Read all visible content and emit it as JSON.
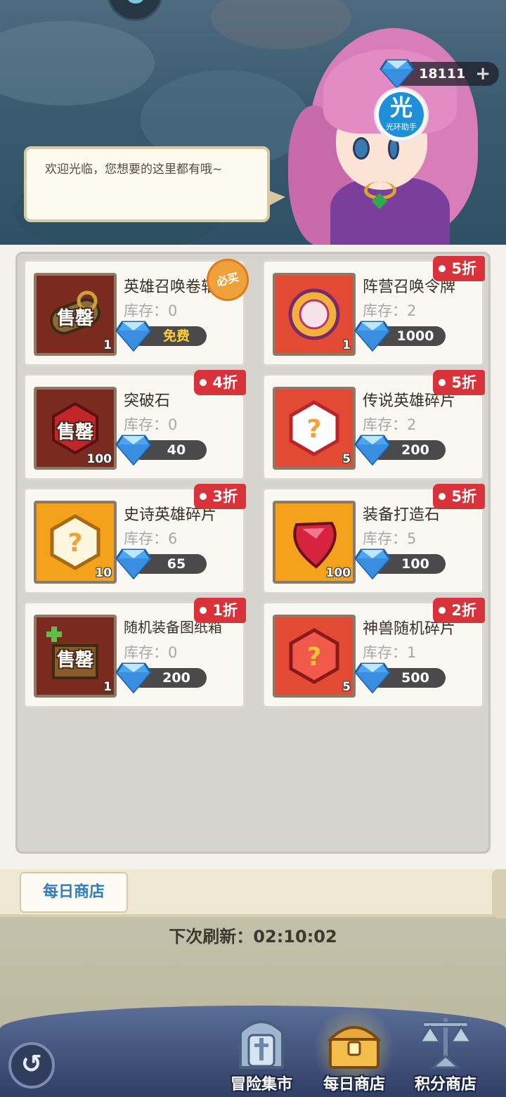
{
  "header": {
    "currency_amount": "18111",
    "currency_plus": "+",
    "assistant_char": "光",
    "assistant_label": "光环助手",
    "greeting": "欢迎光临，您想要的这里都有哦~"
  },
  "items": [
    {
      "name": "英雄召唤卷轴",
      "stock": "库存：0",
      "price": "免费",
      "qty": "1",
      "discount": "",
      "must_buy": "必买",
      "sold_out": "售罄",
      "icon": "scroll-icon",
      "bg": "#7a2a1e"
    },
    {
      "name": "阵营召唤令牌",
      "stock": "库存：2",
      "price": "1000",
      "qty": "1",
      "discount": "5折",
      "must_buy": "",
      "sold_out": "",
      "icon": "faction-token-icon",
      "bg": "#e34a34"
    },
    {
      "name": "突破石",
      "stock": "库存：0",
      "price": "40",
      "qty": "100",
      "discount": "4折",
      "must_buy": "",
      "sold_out": "售罄",
      "icon": "breakthrough-stone-icon",
      "bg": "#7a2a1e"
    },
    {
      "name": "传说英雄碎片",
      "stock": "库存：2",
      "price": "200",
      "qty": "5",
      "discount": "5折",
      "must_buy": "",
      "sold_out": "",
      "icon": "legend-shard-icon",
      "bg": "#e34a34"
    },
    {
      "name": "史诗英雄碎片",
      "stock": "库存：6",
      "price": "65",
      "qty": "10",
      "discount": "3折",
      "must_buy": "",
      "sold_out": "",
      "icon": "epic-shard-icon",
      "bg": "#f4a21c"
    },
    {
      "name": "装备打造石",
      "stock": "库存：5",
      "price": "100",
      "qty": "100",
      "discount": "5折",
      "must_buy": "",
      "sold_out": "",
      "icon": "ruby-icon",
      "bg": "#f4a21c"
    },
    {
      "name": "随机装备图纸箱",
      "stock": "库存：0",
      "price": "200",
      "qty": "1",
      "discount": "1折",
      "must_buy": "",
      "sold_out": "售罄",
      "icon": "blueprint-box-icon",
      "bg": "#7a2a1e"
    },
    {
      "name": "神兽随机碎片",
      "stock": "库存：1",
      "price": "500",
      "qty": "5",
      "discount": "2折",
      "must_buy": "",
      "sold_out": "",
      "icon": "beast-shard-icon",
      "bg": "#e34a34"
    }
  ],
  "shop_tab": "每日商店",
  "refresh_text": "下次刷新：02:10:02",
  "nav": {
    "back_symbol": "↺",
    "items": [
      {
        "label": "冒险集市",
        "icon": "sword-shrine-icon"
      },
      {
        "label": "每日商店",
        "icon": "treasure-chest-icon"
      },
      {
        "label": "积分商店",
        "icon": "scales-icon"
      }
    ]
  },
  "colors": {
    "discount_tag": "#d8323a",
    "price_bar": "#4a4a4a",
    "free_text": "#ffcf3a",
    "tab_text": "#2f7dbf"
  }
}
